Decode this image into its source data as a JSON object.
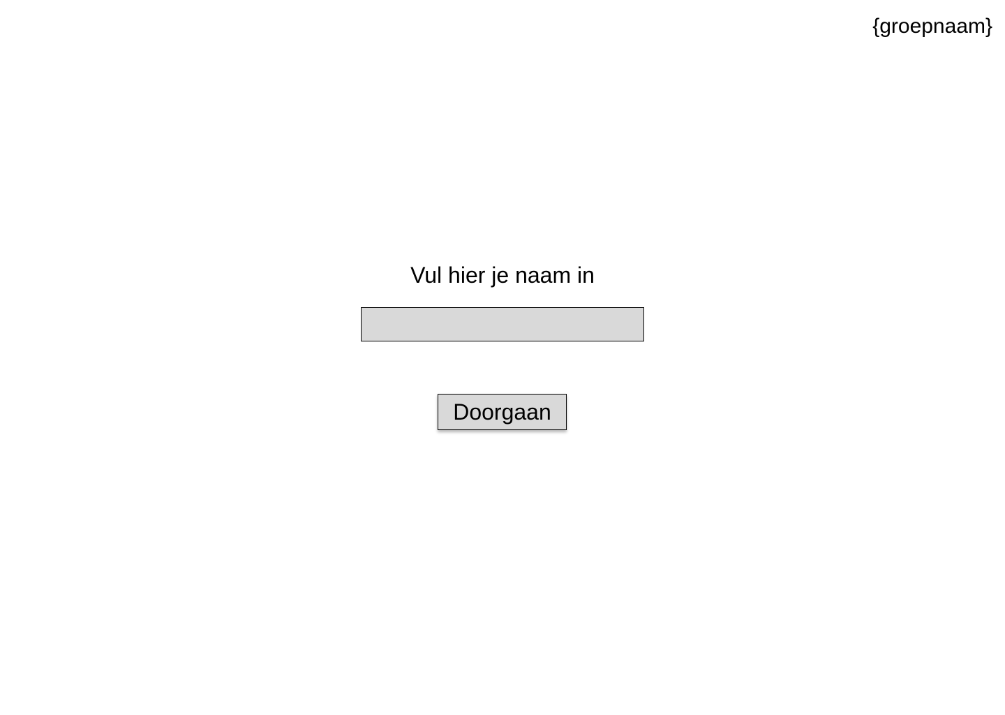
{
  "header": {
    "group_name": "{groepnaam}"
  },
  "form": {
    "prompt": "Vul hier je naam in",
    "name_input": {
      "value": "",
      "placeholder": ""
    },
    "continue_label": "Doorgaan"
  },
  "colors": {
    "background": "#ffffff",
    "field_fill": "#d9d9d9",
    "border": "#000000",
    "text": "#000000"
  }
}
